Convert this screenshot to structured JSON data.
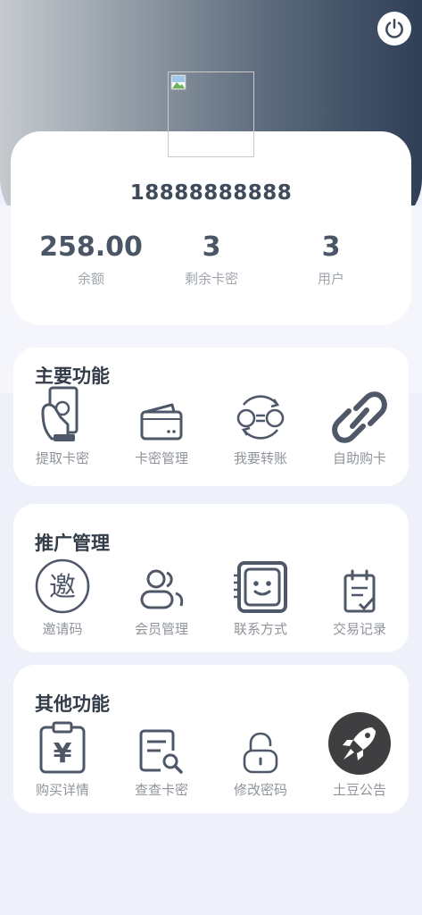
{
  "profile": {
    "phone": "18888888888",
    "stats": [
      {
        "value": "258.00",
        "label": "余额"
      },
      {
        "value": "3",
        "label": "剩余卡密"
      },
      {
        "value": "3",
        "label": "用户"
      }
    ]
  },
  "sections": [
    {
      "title": "主要功能",
      "items": [
        {
          "label": "提取卡密",
          "icon": "cash-withdraw-icon"
        },
        {
          "label": "卡密管理",
          "icon": "wallet-icon"
        },
        {
          "label": "我要转账",
          "icon": "transfer-icon"
        },
        {
          "label": "自助购卡",
          "icon": "link-icon"
        }
      ]
    },
    {
      "title": "推广管理",
      "items": [
        {
          "label": "邀请码",
          "icon": "invite-icon",
          "glyph": "邀"
        },
        {
          "label": "会员管理",
          "icon": "members-icon"
        },
        {
          "label": "联系方式",
          "icon": "contact-face-icon"
        },
        {
          "label": "交易记录",
          "icon": "clipboard-check-icon"
        }
      ]
    },
    {
      "title": "其他功能",
      "items": [
        {
          "label": "购买详情",
          "icon": "yen-clipboard-icon",
          "glyph": "¥"
        },
        {
          "label": "查查卡密",
          "icon": "search-document-icon"
        },
        {
          "label": "修改密码",
          "icon": "lock-icon"
        },
        {
          "label": "土豆公告",
          "icon": "rocket-icon"
        }
      ]
    }
  ],
  "colors": {
    "header_dark": "#2f3f56",
    "header_light": "#c5cacf",
    "icon_stroke": "#4f5868",
    "label_gray": "#8f949b"
  }
}
